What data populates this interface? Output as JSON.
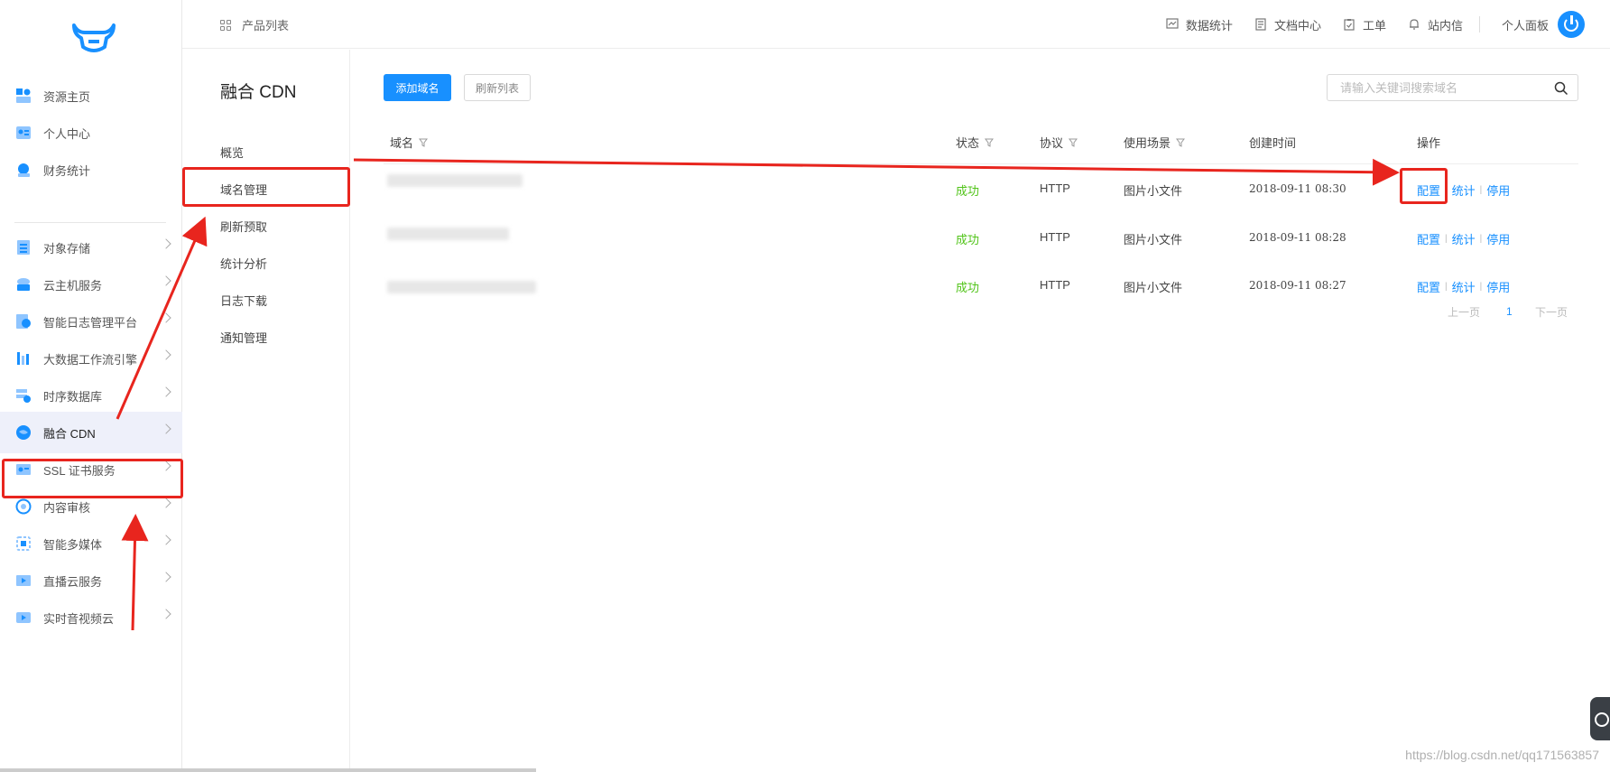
{
  "sidebar": {
    "logo_icon": "bull-head-logo",
    "top_items": [
      {
        "label": "资源主页",
        "icon": "resource-home-icon"
      },
      {
        "label": "个人中心",
        "icon": "personal-center-icon"
      },
      {
        "label": "财务统计",
        "icon": "finance-icon"
      }
    ],
    "service_items": [
      {
        "label": "对象存储",
        "icon": "object-storage-icon"
      },
      {
        "label": "云主机服务",
        "icon": "cloud-host-icon"
      },
      {
        "label": "智能日志管理平台",
        "icon": "log-platform-icon"
      },
      {
        "label": "大数据工作流引擎",
        "icon": "bigdata-workflow-icon"
      },
      {
        "label": "时序数据库",
        "icon": "tsdb-icon"
      },
      {
        "label": "融合 CDN",
        "icon": "cdn-icon",
        "active": true
      },
      {
        "label": "SSL 证书服务",
        "icon": "ssl-icon"
      },
      {
        "label": "内容审核",
        "icon": "content-review-icon"
      },
      {
        "label": "智能多媒体",
        "icon": "multimedia-icon"
      },
      {
        "label": "直播云服务",
        "icon": "live-cloud-icon"
      },
      {
        "label": "实时音视频云",
        "icon": "rtc-icon"
      }
    ]
  },
  "header": {
    "product_list": "产品列表",
    "links": [
      {
        "label": "数据统计",
        "icon": "chart-icon"
      },
      {
        "label": "文档中心",
        "icon": "doc-icon"
      },
      {
        "label": "工单",
        "icon": "ticket-icon"
      },
      {
        "label": "站内信",
        "icon": "bell-icon"
      }
    ],
    "personal_panel": "个人面板"
  },
  "submenu": {
    "title": "融合 CDN",
    "items": [
      "概览",
      "域名管理",
      "刷新预取",
      "统计分析",
      "日志下载",
      "通知管理"
    ],
    "active_index": 1
  },
  "toolbar": {
    "add_domain": "添加域名",
    "refresh_list": "刷新列表",
    "search_placeholder": "请输入关键词搜索域名"
  },
  "table": {
    "columns": [
      "域名",
      "状态",
      "协议",
      "使用场景",
      "创建时间",
      "操作"
    ],
    "rows": [
      {
        "status": "成功",
        "protocol": "HTTP",
        "scene": "图片小文件",
        "created": "2018-09-11 08:30"
      },
      {
        "status": "成功",
        "protocol": "HTTP",
        "scene": "图片小文件",
        "created": "2018-09-11 08:28"
      },
      {
        "status": "成功",
        "protocol": "HTTP",
        "scene": "图片小文件",
        "created": "2018-09-11 08:27"
      }
    ],
    "actions": [
      "配置",
      "统计",
      "停用"
    ]
  },
  "pagination": {
    "prev": "上一页",
    "current": "1",
    "next": "下一页"
  },
  "watermark": "https://blog.csdn.net/qq171563857",
  "colors": {
    "primary": "#1890ff",
    "success": "#52c41a",
    "annotation": "#e8251e"
  }
}
